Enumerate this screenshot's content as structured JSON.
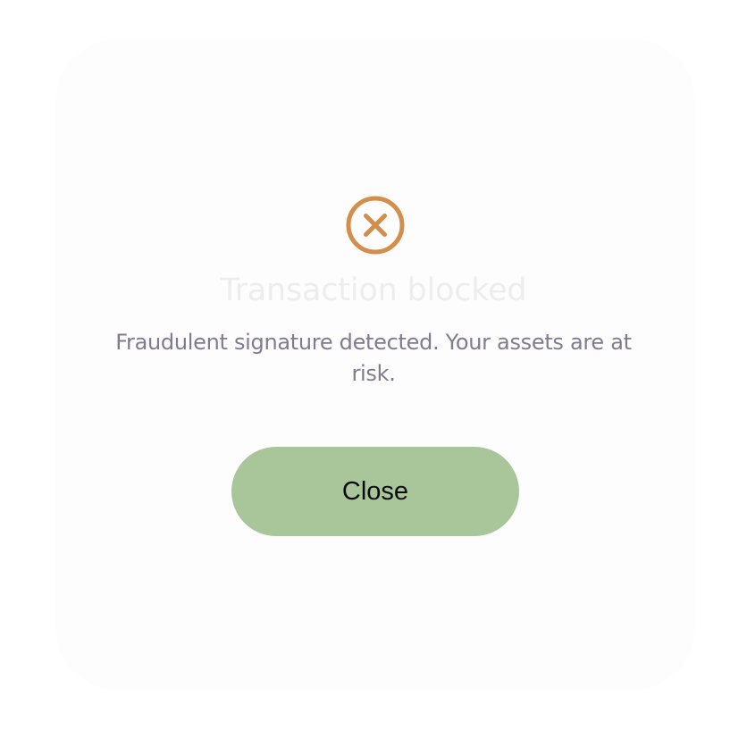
{
  "dialog": {
    "icon": "x-circle-icon",
    "title": "Transaction blocked",
    "message": "Fraudulent signature detected. Your assets are at risk.",
    "close_label": "Close"
  },
  "colors": {
    "icon": "#d28e4a",
    "title": "#ededed",
    "message": "#817a91",
    "button_bg": "#a9c69b",
    "button_text": "#0b0b0b",
    "modal_bg": "#fdfdfd"
  }
}
